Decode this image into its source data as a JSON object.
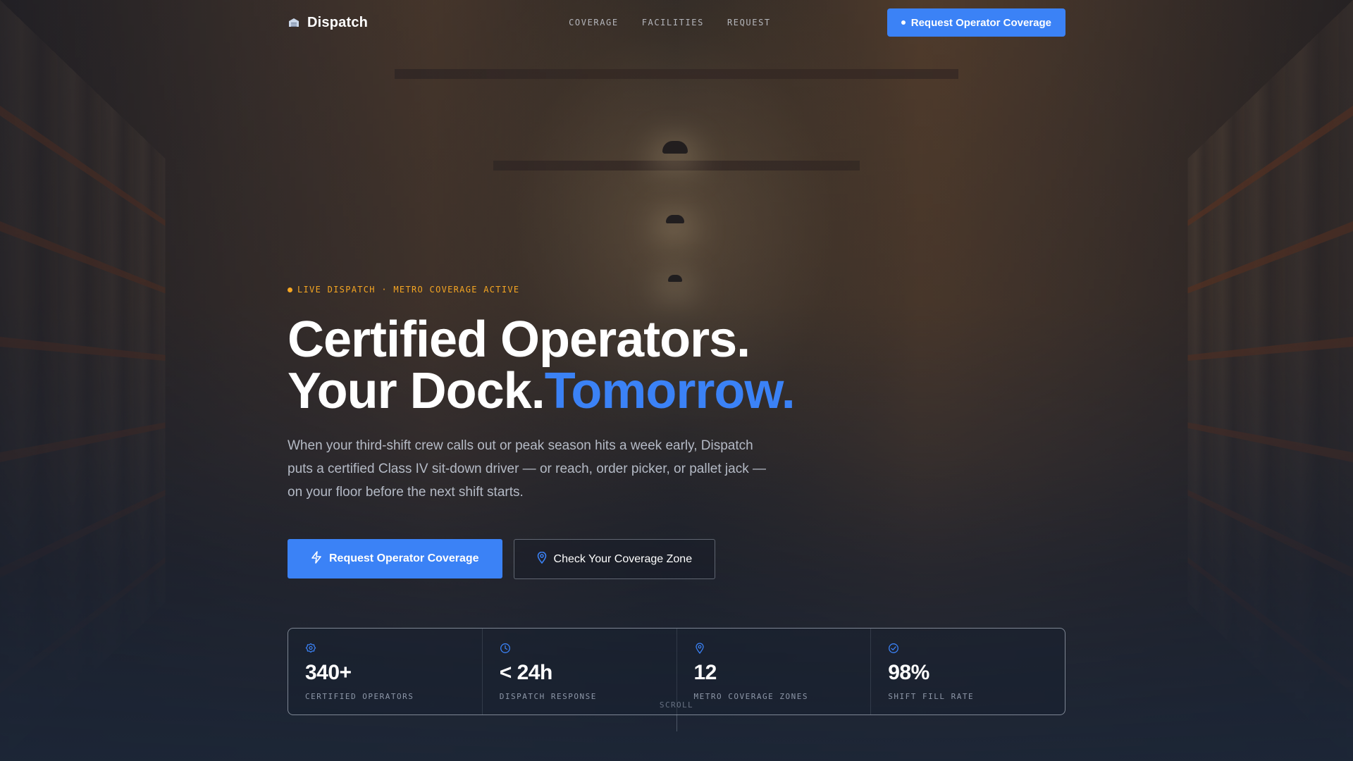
{
  "colors": {
    "accent": "#3b82f6",
    "live_amber": "#f5a623"
  },
  "nav": {
    "brand": {
      "icon": "warehouse-icon",
      "name": "Dispatch"
    },
    "links": [
      "COVERAGE",
      "FACILITIES",
      "REQUEST"
    ],
    "cta_label": "Request Operator Coverage"
  },
  "hero": {
    "live_badge": "LIVE DISPATCH · METRO COVERAGE ACTIVE",
    "headline_line1": "Certified Operators.",
    "headline_line2": "Your Dock.",
    "headline_accent": "Tomorrow.",
    "subheadline": "When your third-shift crew calls out or peak season hits a week early, Dispatch puts a certified Class IV sit-down driver — or reach, order picker, or pallet jack — on your floor before the next shift starts.",
    "primary_cta": {
      "icon": "lightning-icon",
      "label": "Request Operator Coverage"
    },
    "secondary_cta": {
      "icon": "map-pin-icon",
      "label": "Check Your Coverage Zone"
    }
  },
  "stats": [
    {
      "icon": "badge-icon",
      "value": "340+",
      "label": "CERTIFIED OPERATORS"
    },
    {
      "icon": "clock-icon",
      "value": "< 24h",
      "label": "DISPATCH RESPONSE"
    },
    {
      "icon": "map-pin-icon",
      "value": "12",
      "label": "METRO COVERAGE ZONES"
    },
    {
      "icon": "check-circle-icon",
      "value": "98%",
      "label": "SHIFT FILL RATE"
    }
  ],
  "scroll_label": "SCROLL"
}
